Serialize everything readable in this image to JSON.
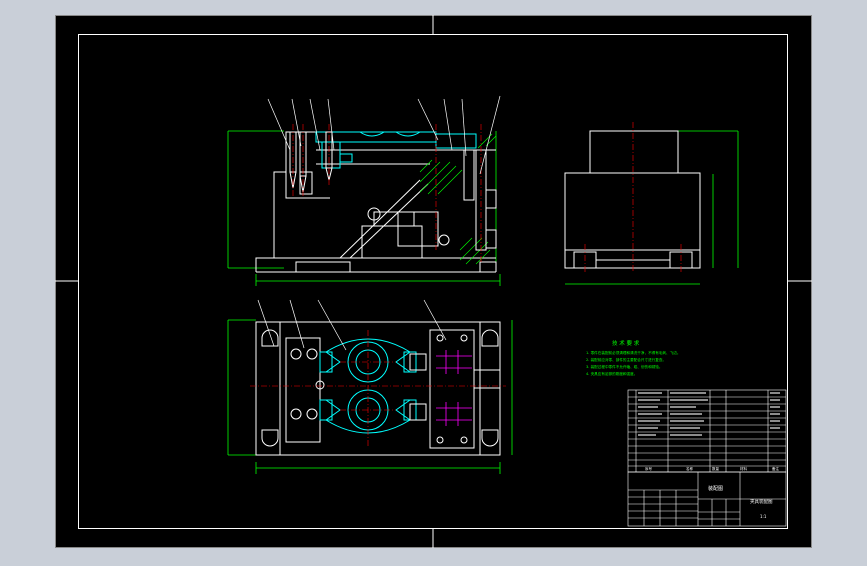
{
  "colors": {
    "background": "#c9cfd8",
    "sheet": "#000000",
    "frame": "#ffffff",
    "geometry": "#ffffff",
    "dimension": "#00ff00",
    "highlight": "#00ffff",
    "centerline": "#ff0000",
    "hatch": "#00ff00",
    "bolt": "#ff00ff"
  },
  "technical_requirements": {
    "title": "技 术 要 求",
    "notes": [
      "1. 零件在装配前必须清理和清洗干净，不得有毛刺、飞边。",
      "2. 装配前应对零、部件的主要配合尺寸进行复查。",
      "3. 装配过程中零件不允许磕、碰、划伤和锈蚀。",
      "4. 夹具应有足够的刚度和强度。"
    ]
  },
  "title_block": {
    "drawing_title": "装配图",
    "part_name": "夹具装配图",
    "scale": "1:1",
    "col_seq": "序号",
    "col_name": "名称",
    "col_qty": "数量",
    "col_material": "材料",
    "col_note": "备注"
  }
}
